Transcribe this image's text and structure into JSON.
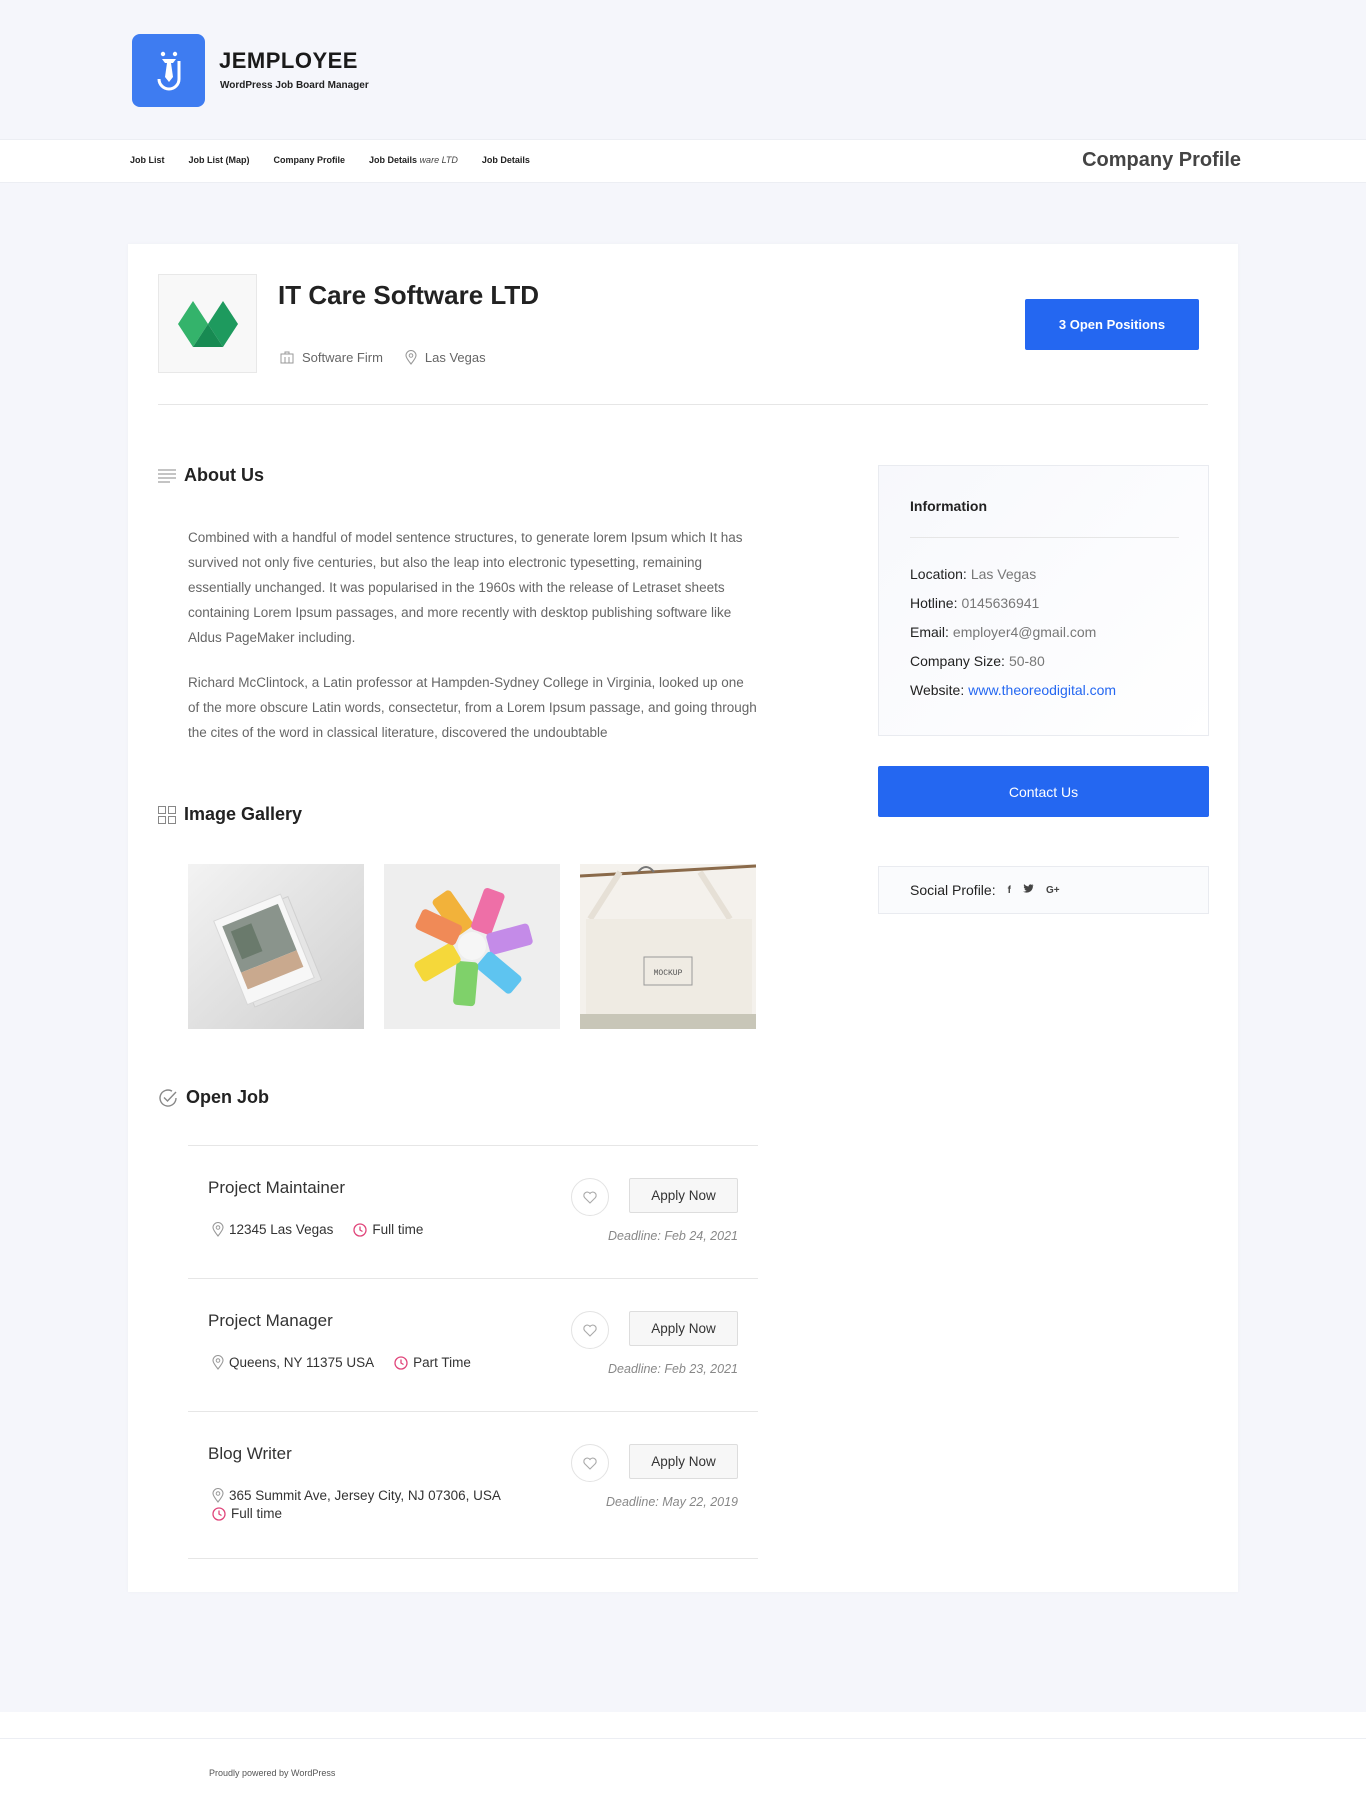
{
  "site": {
    "brand_title": "JEMPLOYEE",
    "brand_subtitle": "WordPress Job Board Manager",
    "accent": "#2467f1"
  },
  "nav": {
    "items": [
      "Job List",
      "Job List (Map)",
      "Company Profile",
      "Job Details",
      "Job Details"
    ],
    "overlap_text": "ware LTD",
    "page_title": "Company Profile"
  },
  "company": {
    "name": "IT Care Software LTD",
    "category": "Software Firm",
    "location": "Las Vegas",
    "open_positions_label": "3 Open Positions"
  },
  "about": {
    "title": "About Us",
    "paragraphs": [
      "Combined with a handful of model sentence structures, to generate lorem Ipsum which It has survived not only five centuries, but also the leap into electronic typesetting, remaining essentially unchanged. It was popularised in the 1960s with the release of Letraset sheets containing Lorem Ipsum passages, and more recently with desktop publishing software like Aldus PageMaker including.",
      "Richard McClintock, a Latin professor at Hampden-Sydney College in Virginia, looked up one of the more obscure Latin words, consectetur, from a Lorem Ipsum passage, and going through the cites of the word in classical literature, discovered the undoubtable"
    ]
  },
  "gallery": {
    "title": "Image Gallery",
    "mockup_text": "MOCKUP"
  },
  "jobs": {
    "title": "Open Job",
    "apply_label": "Apply Now",
    "items": [
      {
        "title": "Project Maintainer",
        "location": "12345 Las Vegas",
        "type": "Full time",
        "deadline": "Deadline: Feb 24, 2021"
      },
      {
        "title": "Project Manager",
        "location": "Queens, NY 11375 USA",
        "type": "Part Time",
        "deadline": "Deadline: Feb 23, 2021"
      },
      {
        "title": "Blog Writer",
        "location": "365 Summit Ave, Jersey City, NJ 07306, USA",
        "type": "Full time",
        "deadline": "Deadline: May 22, 2019"
      }
    ]
  },
  "information": {
    "title": "Information",
    "rows": [
      {
        "label": "Location:",
        "value": "Las Vegas"
      },
      {
        "label": "Hotline:",
        "value": "0145636941"
      },
      {
        "label": "Email:",
        "value": "employer4@gmail.com"
      },
      {
        "label": "Company Size:",
        "value": "50-80"
      },
      {
        "label": "Website:",
        "value": "www.theoreodigital.com"
      }
    ],
    "contact_label": "Contact Us"
  },
  "social": {
    "label": "Social Profile:",
    "icons": [
      "f",
      "t",
      "G+"
    ]
  },
  "footer": {
    "text": "Proudly powered by WordPress"
  }
}
